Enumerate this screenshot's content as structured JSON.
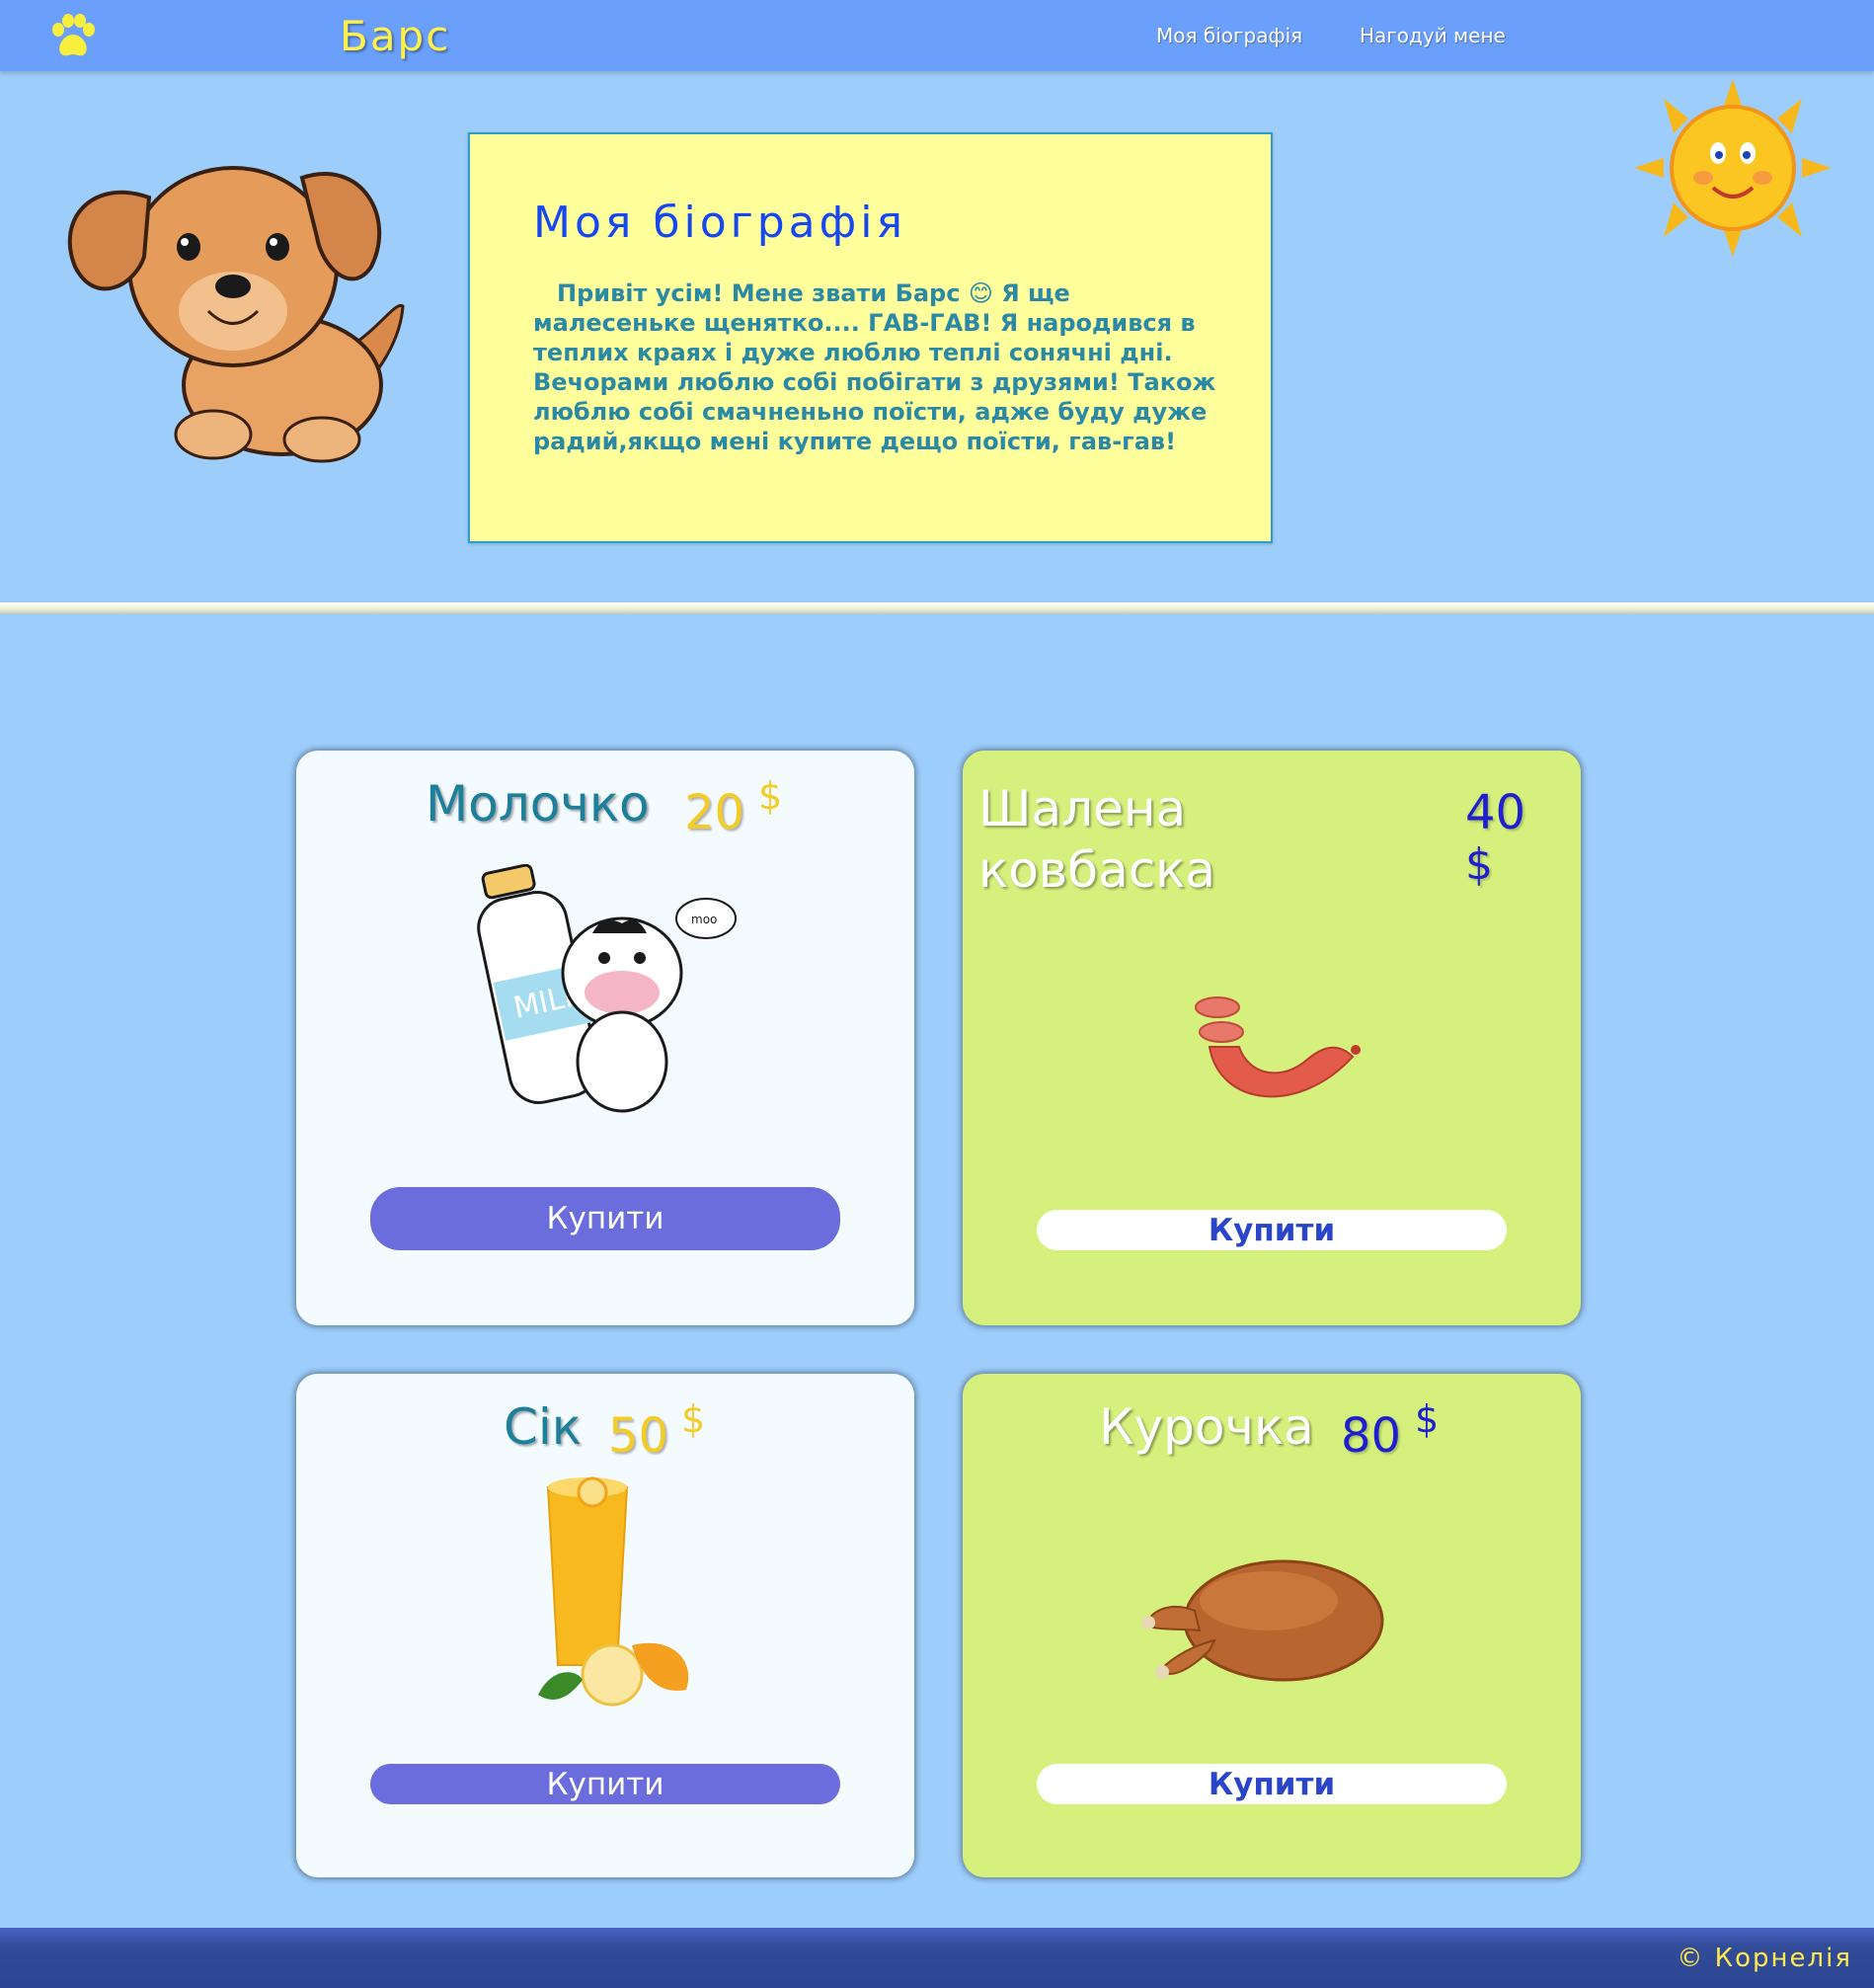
{
  "header": {
    "brand": "Барс",
    "nav": [
      "Моя біографія",
      "Нагодуй мене"
    ]
  },
  "bio": {
    "title": "Моя біографія",
    "text": "Привіт усім! Мене звати Барс 😊 Я ще малесеньке щенятко.... ГАВ-ГАВ! Я народився в теплих краях і дуже люблю теплі сонячні дні. Вечорами люблю собі побігати з друзями! Також люблю собі смачненьно поїсти, адже буду дуже радий,якщо мені купите дещо поїсти, гав-гав!"
  },
  "products": [
    {
      "name": "Молочко",
      "price": "20",
      "currency": "$",
      "buy": "Купити"
    },
    {
      "name": "Шалена ковбаска",
      "price": "40",
      "currency": "$",
      "buy": "Купити"
    },
    {
      "name": "Сік",
      "price": "50",
      "currency": "$",
      "buy": "Купити"
    },
    {
      "name": "Курочка",
      "price": "80",
      "currency": "$",
      "buy": "Купити"
    }
  ],
  "footer": {
    "copyright": "© Корнелія"
  },
  "colors": {
    "header": "#6aa0fb",
    "page_background": "#9dcdfb",
    "bio_box": "#ffff9c",
    "card_green": "#d5f07c",
    "button_purple": "#6a6ddb",
    "footer": "#2c4694"
  },
  "icons": {
    "logo": "paw-icon"
  }
}
